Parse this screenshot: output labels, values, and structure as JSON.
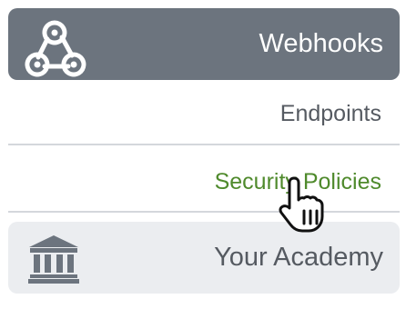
{
  "menu": {
    "webhooks": {
      "label": "Webhooks",
      "icon": "webhook-icon"
    },
    "items": [
      {
        "label": "Endpoints"
      },
      {
        "label": "Security Policies",
        "state": "hover"
      }
    ],
    "academy": {
      "label": "Your Academy",
      "icon": "institution-icon"
    }
  },
  "colors": {
    "header_bg": "#6c747e",
    "active_link": "#4f8a2c",
    "text": "#555a61",
    "academy_bg": "#ebedf0"
  },
  "cursor": "pointer-hand"
}
